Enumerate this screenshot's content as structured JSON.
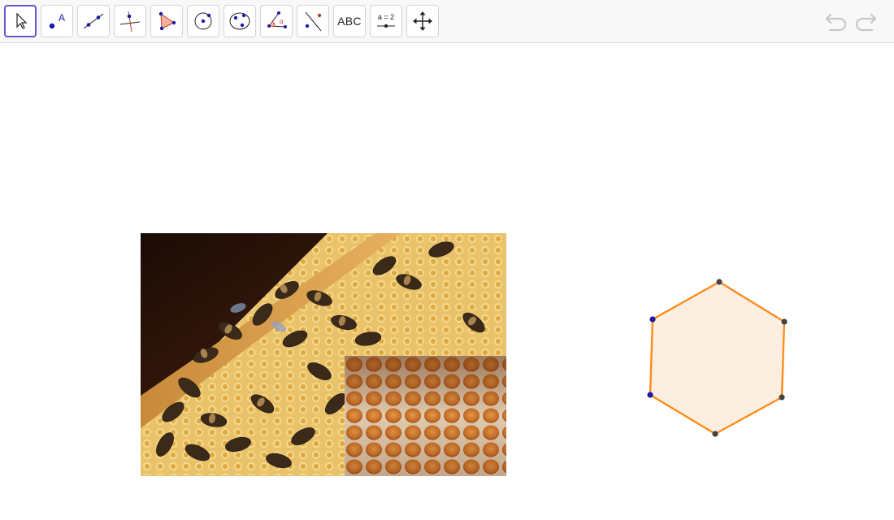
{
  "toolbar": {
    "tools": [
      {
        "name": "move-tool",
        "icon": "cursor-arrow-icon",
        "active": true
      },
      {
        "name": "point-tool",
        "icon": "point-icon",
        "label": "A"
      },
      {
        "name": "line-tool",
        "icon": "line-through-points-icon"
      },
      {
        "name": "perpendicular-tool",
        "icon": "perpendicular-line-icon"
      },
      {
        "name": "polygon-tool",
        "icon": "polygon-icon"
      },
      {
        "name": "circle-tool",
        "icon": "circle-center-point-icon"
      },
      {
        "name": "conic-tool",
        "icon": "ellipse-icon"
      },
      {
        "name": "angle-tool",
        "icon": "angle-icon",
        "label": "α"
      },
      {
        "name": "reflect-tool",
        "icon": "reflect-about-line-icon"
      },
      {
        "name": "text-tool",
        "icon": "text-icon",
        "label": "ABC"
      },
      {
        "name": "slider-tool",
        "icon": "slider-icon",
        "label": "a = 2"
      },
      {
        "name": "move-view-tool",
        "icon": "move-graphics-view-icon"
      }
    ],
    "undo_icon": "undo-icon",
    "redo_icon": "redo-icon"
  },
  "colors": {
    "accent": "#6557d2",
    "point_blue": "#1a1aa6",
    "point_dark": "#444444",
    "hexagon_stroke": "#ff8c1a",
    "hexagon_fill": "#fdeee2"
  },
  "images": {
    "bees_photo": "bees-on-honeycomb-photo",
    "honeycomb_photo": "honeycomb-closeup-photo"
  },
  "hexagon": {
    "shape": "regular-hexagon"
  }
}
